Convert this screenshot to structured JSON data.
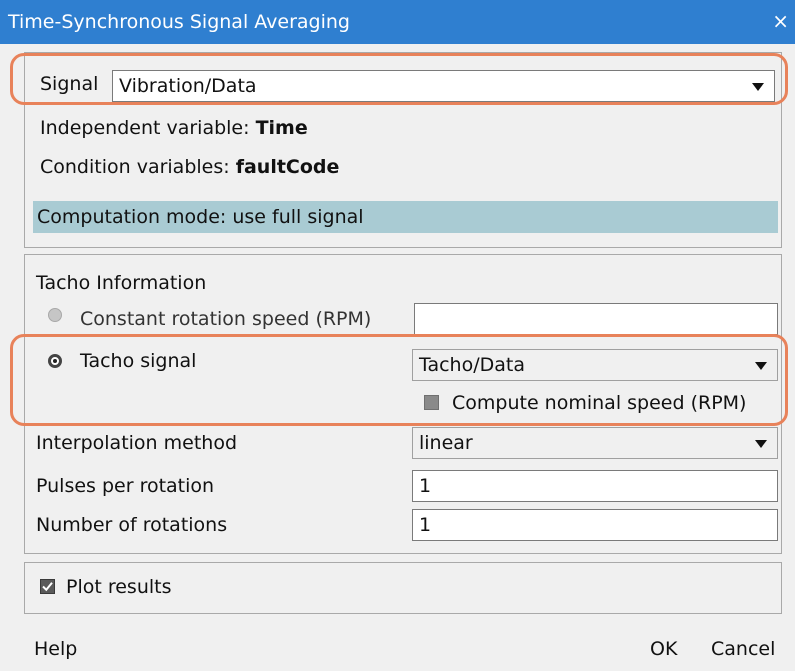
{
  "window": {
    "title": "Time-Synchronous Signal Averaging",
    "close_glyph": "×"
  },
  "signal_section": {
    "signal_label": "Signal",
    "signal_value": "Vibration/Data",
    "independent_label": "Independent variable: ",
    "independent_value": "Time",
    "condition_label": "Condition variables: ",
    "condition_value": "faultCode",
    "computation_mode": "Computation mode: use full signal"
  },
  "tacho_section": {
    "heading": "Tacho Information",
    "constant_speed_label": "Constant rotation speed (RPM)",
    "constant_speed_value": "",
    "tacho_signal_label": "Tacho signal",
    "tacho_signal_value": "Tacho/Data",
    "compute_nominal_label": "Compute nominal speed (RPM)",
    "compute_nominal_checked": false,
    "interpolation_label": "Interpolation method",
    "interpolation_value": "linear",
    "pulses_label": "Pulses per rotation",
    "pulses_value": "1",
    "rotations_label": "Number of rotations",
    "rotations_value": "1"
  },
  "plot_section": {
    "plot_label": "Plot results",
    "plot_checked": true
  },
  "footer": {
    "help_label": "Help",
    "ok_label": "OK",
    "cancel_label": "Cancel"
  },
  "colors": {
    "title_bar": "#2f7fd0",
    "highlight_outline": "#e8825a",
    "mode_bar": "#a9cbd3"
  }
}
